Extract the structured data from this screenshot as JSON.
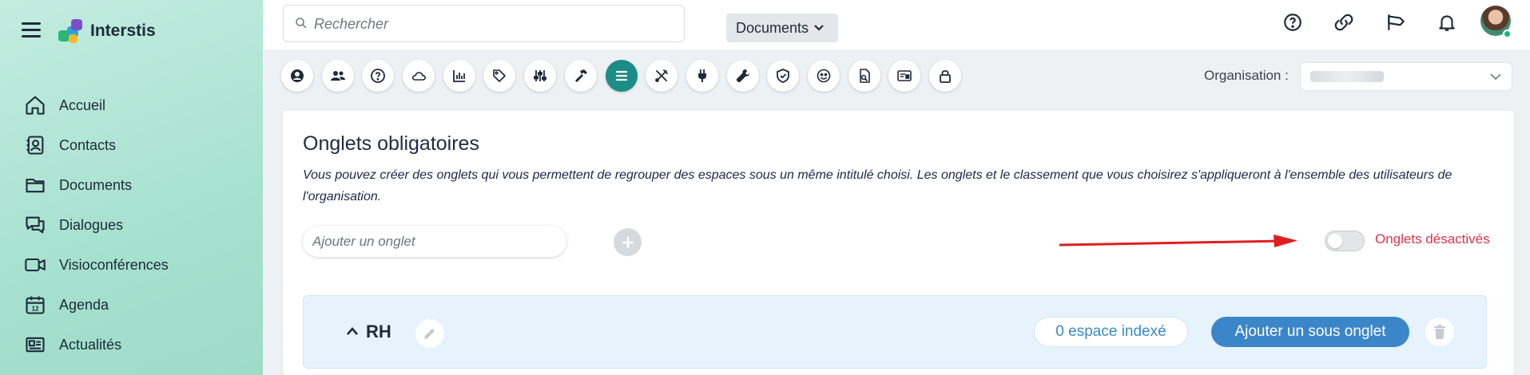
{
  "app": {
    "brand": "Interstis"
  },
  "colors": {
    "accent": "#1b8c86",
    "primary_button": "#3b86c9",
    "warning_text": "#e0334b",
    "sidebar": "#b0e5d5"
  },
  "sidebar": {
    "items": [
      {
        "label": "Accueil",
        "icon": "home-icon"
      },
      {
        "label": "Contacts",
        "icon": "contacts-icon"
      },
      {
        "label": "Documents",
        "icon": "folder-icon"
      },
      {
        "label": "Dialogues",
        "icon": "chat-icon"
      },
      {
        "label": "Visioconférences",
        "icon": "video-icon"
      },
      {
        "label": "Agenda",
        "icon": "calendar-icon"
      },
      {
        "label": "Actualités",
        "icon": "news-icon"
      }
    ]
  },
  "search": {
    "placeholder": "Rechercher",
    "scope": "Documents"
  },
  "toolbar": {
    "icons": [
      "user-icon",
      "users-icon",
      "help-icon",
      "cloud-icon",
      "stats-icon",
      "tag-icon",
      "sliders-icon",
      "hammer-icon",
      "list-icon",
      "tools-icon",
      "plug-icon",
      "wrench-icon",
      "shield-icon",
      "smiley-icon",
      "file-search-icon",
      "id-card-icon",
      "lock-icon"
    ],
    "active": "list-icon"
  },
  "org": {
    "label": "Organisation :"
  },
  "panel": {
    "title": "Onglets obligatoires",
    "description": "Vous pouvez créer des onglets qui vous permettent de regrouper des espaces sous un même intitulé choisi. Les onglets et le classement que vous choisirez s'appliqueront à l'ensemble des utilisateurs de l'organisation.",
    "add_placeholder": "Ajouter un onglet",
    "toggle_label": "Onglets désactivés",
    "toggle_on": false
  },
  "tab_row": {
    "name": "RH",
    "count_label": "0 espace indexé",
    "add_sub_label": "Ajouter un sous onglet"
  }
}
